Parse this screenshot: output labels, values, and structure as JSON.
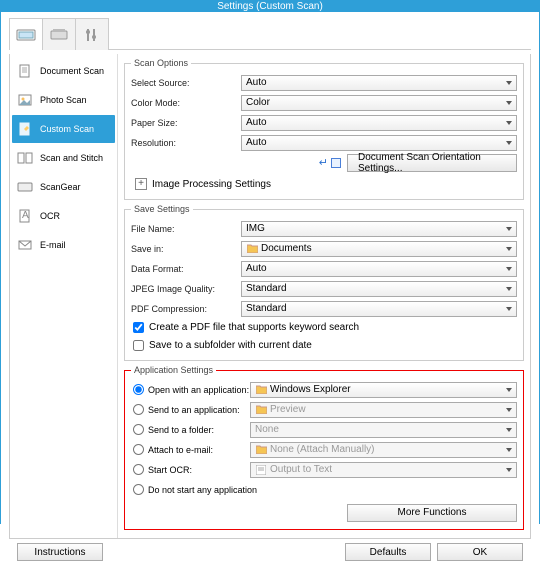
{
  "window": {
    "title": "Settings (Custom Scan)"
  },
  "sidebar": {
    "items": [
      {
        "label": "Document Scan"
      },
      {
        "label": "Photo Scan"
      },
      {
        "label": "Custom Scan"
      },
      {
        "label": "Scan and Stitch"
      },
      {
        "label": "ScanGear"
      },
      {
        "label": "OCR"
      },
      {
        "label": "E-mail"
      }
    ]
  },
  "scan_options": {
    "title": "Scan Options",
    "select_source": {
      "label": "Select Source:",
      "value": "Auto"
    },
    "color_mode": {
      "label": "Color Mode:",
      "value": "Color"
    },
    "paper_size": {
      "label": "Paper Size:",
      "value": "Auto"
    },
    "resolution": {
      "label": "Resolution:",
      "value": "Auto"
    },
    "orientation_button": "Document Scan Orientation Settings...",
    "image_processing": "Image Processing Settings"
  },
  "save_settings": {
    "title": "Save Settings",
    "file_name": {
      "label": "File Name:",
      "value": "IMG"
    },
    "save_in": {
      "label": "Save in:",
      "value": "Documents"
    },
    "data_format": {
      "label": "Data Format:",
      "value": "Auto"
    },
    "jpeg_quality": {
      "label": "JPEG Image Quality:",
      "value": "Standard"
    },
    "pdf_compression": {
      "label": "PDF Compression:",
      "value": "Standard"
    },
    "pdf_keyword": "Create a PDF file that supports keyword search",
    "save_subfolder": "Save to a subfolder with current date"
  },
  "app_settings": {
    "title": "Application Settings",
    "open_app": {
      "label": "Open with an application:",
      "value": "Windows Explorer"
    },
    "send_app": {
      "label": "Send to an application:",
      "value": "Preview"
    },
    "send_folder": {
      "label": "Send to a folder:",
      "value": "None"
    },
    "attach_email": {
      "label": "Attach to e-mail:",
      "value": "None (Attach Manually)"
    },
    "start_ocr": {
      "label": "Start OCR:",
      "value": "Output to Text"
    },
    "do_not_start": "Do not start any application",
    "more_functions": "More Functions"
  },
  "buttons": {
    "instructions": "Instructions",
    "defaults": "Defaults",
    "ok": "OK"
  }
}
